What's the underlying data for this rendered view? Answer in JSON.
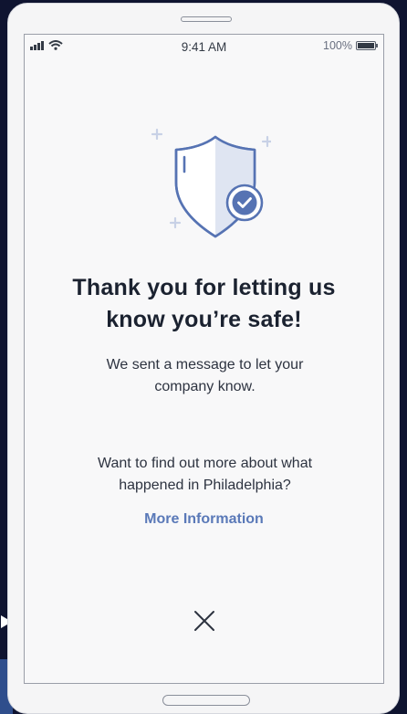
{
  "status_bar": {
    "time": "9:41 AM",
    "battery_label": "100%",
    "icons": [
      "signal-icon",
      "wifi-icon",
      "battery-icon"
    ]
  },
  "content": {
    "title_line1": "Thank you for letting us",
    "title_line2": "know you’re safe!",
    "subtitle": "We sent a message to let your company know.",
    "prompt": "Want to find out more about what happened in Philadelphia?",
    "link_label": "More Information",
    "close_icon": "close-icon",
    "illustration_icon": "shield-check-icon"
  },
  "colors": {
    "accent": "#5a79b8",
    "title": "#1b2230",
    "body": "#2d3340",
    "shield_fill": "#dfe5f2",
    "shield_stroke": "#5673b3",
    "sparkle": "#c8d1e6",
    "background": "#0f1430"
  }
}
